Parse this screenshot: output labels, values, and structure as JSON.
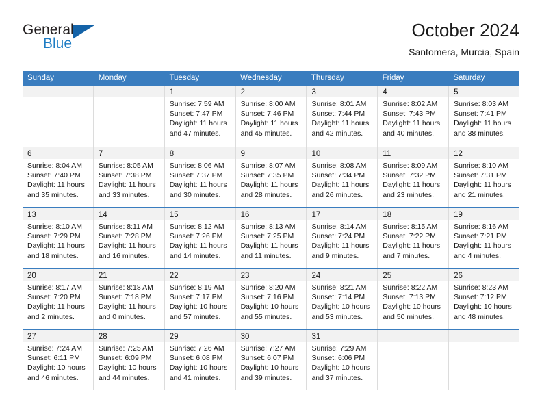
{
  "brand": {
    "word1": "General",
    "word2": "Blue",
    "logo_icon": "blue-triangle-logo"
  },
  "header": {
    "title": "October 2024",
    "subtitle": "Santomera, Murcia, Spain"
  },
  "colors": {
    "header_blue": "#3a7dbf",
    "brand_blue": "#1f7dc4",
    "logo_blue": "#1463a8",
    "day_band_gray": "#f2f2f2",
    "cell_border": "#dcdcdc",
    "text": "#1a1a1a"
  },
  "calendar": {
    "weekdays": [
      "Sunday",
      "Monday",
      "Tuesday",
      "Wednesday",
      "Thursday",
      "Friday",
      "Saturday"
    ],
    "weeks": [
      [
        {
          "day": "",
          "sunrise": "",
          "sunset": "",
          "daylight": ""
        },
        {
          "day": "",
          "sunrise": "",
          "sunset": "",
          "daylight": ""
        },
        {
          "day": "1",
          "sunrise": "Sunrise: 7:59 AM",
          "sunset": "Sunset: 7:47 PM",
          "daylight": "Daylight: 11 hours and 47 minutes."
        },
        {
          "day": "2",
          "sunrise": "Sunrise: 8:00 AM",
          "sunset": "Sunset: 7:46 PM",
          "daylight": "Daylight: 11 hours and 45 minutes."
        },
        {
          "day": "3",
          "sunrise": "Sunrise: 8:01 AM",
          "sunset": "Sunset: 7:44 PM",
          "daylight": "Daylight: 11 hours and 42 minutes."
        },
        {
          "day": "4",
          "sunrise": "Sunrise: 8:02 AM",
          "sunset": "Sunset: 7:43 PM",
          "daylight": "Daylight: 11 hours and 40 minutes."
        },
        {
          "day": "5",
          "sunrise": "Sunrise: 8:03 AM",
          "sunset": "Sunset: 7:41 PM",
          "daylight": "Daylight: 11 hours and 38 minutes."
        }
      ],
      [
        {
          "day": "6",
          "sunrise": "Sunrise: 8:04 AM",
          "sunset": "Sunset: 7:40 PM",
          "daylight": "Daylight: 11 hours and 35 minutes."
        },
        {
          "day": "7",
          "sunrise": "Sunrise: 8:05 AM",
          "sunset": "Sunset: 7:38 PM",
          "daylight": "Daylight: 11 hours and 33 minutes."
        },
        {
          "day": "8",
          "sunrise": "Sunrise: 8:06 AM",
          "sunset": "Sunset: 7:37 PM",
          "daylight": "Daylight: 11 hours and 30 minutes."
        },
        {
          "day": "9",
          "sunrise": "Sunrise: 8:07 AM",
          "sunset": "Sunset: 7:35 PM",
          "daylight": "Daylight: 11 hours and 28 minutes."
        },
        {
          "day": "10",
          "sunrise": "Sunrise: 8:08 AM",
          "sunset": "Sunset: 7:34 PM",
          "daylight": "Daylight: 11 hours and 26 minutes."
        },
        {
          "day": "11",
          "sunrise": "Sunrise: 8:09 AM",
          "sunset": "Sunset: 7:32 PM",
          "daylight": "Daylight: 11 hours and 23 minutes."
        },
        {
          "day": "12",
          "sunrise": "Sunrise: 8:10 AM",
          "sunset": "Sunset: 7:31 PM",
          "daylight": "Daylight: 11 hours and 21 minutes."
        }
      ],
      [
        {
          "day": "13",
          "sunrise": "Sunrise: 8:10 AM",
          "sunset": "Sunset: 7:29 PM",
          "daylight": "Daylight: 11 hours and 18 minutes."
        },
        {
          "day": "14",
          "sunrise": "Sunrise: 8:11 AM",
          "sunset": "Sunset: 7:28 PM",
          "daylight": "Daylight: 11 hours and 16 minutes."
        },
        {
          "day": "15",
          "sunrise": "Sunrise: 8:12 AM",
          "sunset": "Sunset: 7:26 PM",
          "daylight": "Daylight: 11 hours and 14 minutes."
        },
        {
          "day": "16",
          "sunrise": "Sunrise: 8:13 AM",
          "sunset": "Sunset: 7:25 PM",
          "daylight": "Daylight: 11 hours and 11 minutes."
        },
        {
          "day": "17",
          "sunrise": "Sunrise: 8:14 AM",
          "sunset": "Sunset: 7:24 PM",
          "daylight": "Daylight: 11 hours and 9 minutes."
        },
        {
          "day": "18",
          "sunrise": "Sunrise: 8:15 AM",
          "sunset": "Sunset: 7:22 PM",
          "daylight": "Daylight: 11 hours and 7 minutes."
        },
        {
          "day": "19",
          "sunrise": "Sunrise: 8:16 AM",
          "sunset": "Sunset: 7:21 PM",
          "daylight": "Daylight: 11 hours and 4 minutes."
        }
      ],
      [
        {
          "day": "20",
          "sunrise": "Sunrise: 8:17 AM",
          "sunset": "Sunset: 7:20 PM",
          "daylight": "Daylight: 11 hours and 2 minutes."
        },
        {
          "day": "21",
          "sunrise": "Sunrise: 8:18 AM",
          "sunset": "Sunset: 7:18 PM",
          "daylight": "Daylight: 11 hours and 0 minutes."
        },
        {
          "day": "22",
          "sunrise": "Sunrise: 8:19 AM",
          "sunset": "Sunset: 7:17 PM",
          "daylight": "Daylight: 10 hours and 57 minutes."
        },
        {
          "day": "23",
          "sunrise": "Sunrise: 8:20 AM",
          "sunset": "Sunset: 7:16 PM",
          "daylight": "Daylight: 10 hours and 55 minutes."
        },
        {
          "day": "24",
          "sunrise": "Sunrise: 8:21 AM",
          "sunset": "Sunset: 7:14 PM",
          "daylight": "Daylight: 10 hours and 53 minutes."
        },
        {
          "day": "25",
          "sunrise": "Sunrise: 8:22 AM",
          "sunset": "Sunset: 7:13 PM",
          "daylight": "Daylight: 10 hours and 50 minutes."
        },
        {
          "day": "26",
          "sunrise": "Sunrise: 8:23 AM",
          "sunset": "Sunset: 7:12 PM",
          "daylight": "Daylight: 10 hours and 48 minutes."
        }
      ],
      [
        {
          "day": "27",
          "sunrise": "Sunrise: 7:24 AM",
          "sunset": "Sunset: 6:11 PM",
          "daylight": "Daylight: 10 hours and 46 minutes."
        },
        {
          "day": "28",
          "sunrise": "Sunrise: 7:25 AM",
          "sunset": "Sunset: 6:09 PM",
          "daylight": "Daylight: 10 hours and 44 minutes."
        },
        {
          "day": "29",
          "sunrise": "Sunrise: 7:26 AM",
          "sunset": "Sunset: 6:08 PM",
          "daylight": "Daylight: 10 hours and 41 minutes."
        },
        {
          "day": "30",
          "sunrise": "Sunrise: 7:27 AM",
          "sunset": "Sunset: 6:07 PM",
          "daylight": "Daylight: 10 hours and 39 minutes."
        },
        {
          "day": "31",
          "sunrise": "Sunrise: 7:29 AM",
          "sunset": "Sunset: 6:06 PM",
          "daylight": "Daylight: 10 hours and 37 minutes."
        },
        {
          "day": "",
          "sunrise": "",
          "sunset": "",
          "daylight": ""
        },
        {
          "day": "",
          "sunrise": "",
          "sunset": "",
          "daylight": ""
        }
      ]
    ]
  }
}
